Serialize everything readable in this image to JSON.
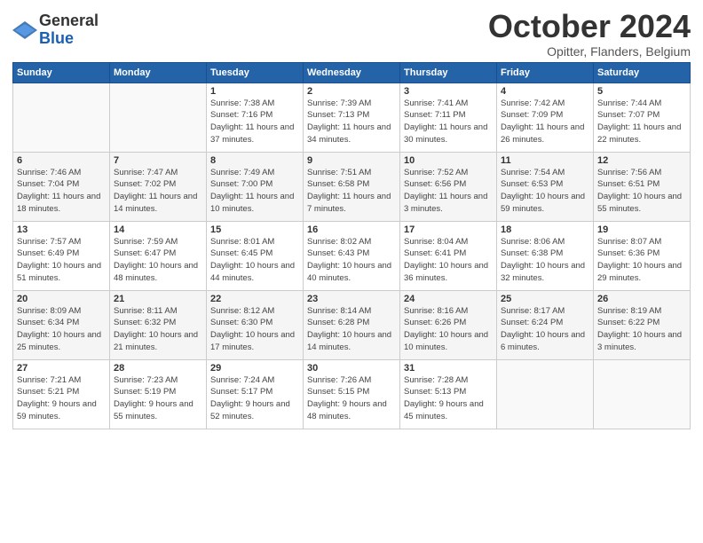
{
  "header": {
    "logo_general": "General",
    "logo_blue": "Blue",
    "month": "October 2024",
    "location": "Opitter, Flanders, Belgium"
  },
  "weekdays": [
    "Sunday",
    "Monday",
    "Tuesday",
    "Wednesday",
    "Thursday",
    "Friday",
    "Saturday"
  ],
  "weeks": [
    [
      {
        "day": "",
        "sunrise": "",
        "sunset": "",
        "daylight": ""
      },
      {
        "day": "",
        "sunrise": "",
        "sunset": "",
        "daylight": ""
      },
      {
        "day": "1",
        "sunrise": "Sunrise: 7:38 AM",
        "sunset": "Sunset: 7:16 PM",
        "daylight": "Daylight: 11 hours and 37 minutes."
      },
      {
        "day": "2",
        "sunrise": "Sunrise: 7:39 AM",
        "sunset": "Sunset: 7:13 PM",
        "daylight": "Daylight: 11 hours and 34 minutes."
      },
      {
        "day": "3",
        "sunrise": "Sunrise: 7:41 AM",
        "sunset": "Sunset: 7:11 PM",
        "daylight": "Daylight: 11 hours and 30 minutes."
      },
      {
        "day": "4",
        "sunrise": "Sunrise: 7:42 AM",
        "sunset": "Sunset: 7:09 PM",
        "daylight": "Daylight: 11 hours and 26 minutes."
      },
      {
        "day": "5",
        "sunrise": "Sunrise: 7:44 AM",
        "sunset": "Sunset: 7:07 PM",
        "daylight": "Daylight: 11 hours and 22 minutes."
      }
    ],
    [
      {
        "day": "6",
        "sunrise": "Sunrise: 7:46 AM",
        "sunset": "Sunset: 7:04 PM",
        "daylight": "Daylight: 11 hours and 18 minutes."
      },
      {
        "day": "7",
        "sunrise": "Sunrise: 7:47 AM",
        "sunset": "Sunset: 7:02 PM",
        "daylight": "Daylight: 11 hours and 14 minutes."
      },
      {
        "day": "8",
        "sunrise": "Sunrise: 7:49 AM",
        "sunset": "Sunset: 7:00 PM",
        "daylight": "Daylight: 11 hours and 10 minutes."
      },
      {
        "day": "9",
        "sunrise": "Sunrise: 7:51 AM",
        "sunset": "Sunset: 6:58 PM",
        "daylight": "Daylight: 11 hours and 7 minutes."
      },
      {
        "day": "10",
        "sunrise": "Sunrise: 7:52 AM",
        "sunset": "Sunset: 6:56 PM",
        "daylight": "Daylight: 11 hours and 3 minutes."
      },
      {
        "day": "11",
        "sunrise": "Sunrise: 7:54 AM",
        "sunset": "Sunset: 6:53 PM",
        "daylight": "Daylight: 10 hours and 59 minutes."
      },
      {
        "day": "12",
        "sunrise": "Sunrise: 7:56 AM",
        "sunset": "Sunset: 6:51 PM",
        "daylight": "Daylight: 10 hours and 55 minutes."
      }
    ],
    [
      {
        "day": "13",
        "sunrise": "Sunrise: 7:57 AM",
        "sunset": "Sunset: 6:49 PM",
        "daylight": "Daylight: 10 hours and 51 minutes."
      },
      {
        "day": "14",
        "sunrise": "Sunrise: 7:59 AM",
        "sunset": "Sunset: 6:47 PM",
        "daylight": "Daylight: 10 hours and 48 minutes."
      },
      {
        "day": "15",
        "sunrise": "Sunrise: 8:01 AM",
        "sunset": "Sunset: 6:45 PM",
        "daylight": "Daylight: 10 hours and 44 minutes."
      },
      {
        "day": "16",
        "sunrise": "Sunrise: 8:02 AM",
        "sunset": "Sunset: 6:43 PM",
        "daylight": "Daylight: 10 hours and 40 minutes."
      },
      {
        "day": "17",
        "sunrise": "Sunrise: 8:04 AM",
        "sunset": "Sunset: 6:41 PM",
        "daylight": "Daylight: 10 hours and 36 minutes."
      },
      {
        "day": "18",
        "sunrise": "Sunrise: 8:06 AM",
        "sunset": "Sunset: 6:38 PM",
        "daylight": "Daylight: 10 hours and 32 minutes."
      },
      {
        "day": "19",
        "sunrise": "Sunrise: 8:07 AM",
        "sunset": "Sunset: 6:36 PM",
        "daylight": "Daylight: 10 hours and 29 minutes."
      }
    ],
    [
      {
        "day": "20",
        "sunrise": "Sunrise: 8:09 AM",
        "sunset": "Sunset: 6:34 PM",
        "daylight": "Daylight: 10 hours and 25 minutes."
      },
      {
        "day": "21",
        "sunrise": "Sunrise: 8:11 AM",
        "sunset": "Sunset: 6:32 PM",
        "daylight": "Daylight: 10 hours and 21 minutes."
      },
      {
        "day": "22",
        "sunrise": "Sunrise: 8:12 AM",
        "sunset": "Sunset: 6:30 PM",
        "daylight": "Daylight: 10 hours and 17 minutes."
      },
      {
        "day": "23",
        "sunrise": "Sunrise: 8:14 AM",
        "sunset": "Sunset: 6:28 PM",
        "daylight": "Daylight: 10 hours and 14 minutes."
      },
      {
        "day": "24",
        "sunrise": "Sunrise: 8:16 AM",
        "sunset": "Sunset: 6:26 PM",
        "daylight": "Daylight: 10 hours and 10 minutes."
      },
      {
        "day": "25",
        "sunrise": "Sunrise: 8:17 AM",
        "sunset": "Sunset: 6:24 PM",
        "daylight": "Daylight: 10 hours and 6 minutes."
      },
      {
        "day": "26",
        "sunrise": "Sunrise: 8:19 AM",
        "sunset": "Sunset: 6:22 PM",
        "daylight": "Daylight: 10 hours and 3 minutes."
      }
    ],
    [
      {
        "day": "27",
        "sunrise": "Sunrise: 7:21 AM",
        "sunset": "Sunset: 5:21 PM",
        "daylight": "Daylight: 9 hours and 59 minutes."
      },
      {
        "day": "28",
        "sunrise": "Sunrise: 7:23 AM",
        "sunset": "Sunset: 5:19 PM",
        "daylight": "Daylight: 9 hours and 55 minutes."
      },
      {
        "day": "29",
        "sunrise": "Sunrise: 7:24 AM",
        "sunset": "Sunset: 5:17 PM",
        "daylight": "Daylight: 9 hours and 52 minutes."
      },
      {
        "day": "30",
        "sunrise": "Sunrise: 7:26 AM",
        "sunset": "Sunset: 5:15 PM",
        "daylight": "Daylight: 9 hours and 48 minutes."
      },
      {
        "day": "31",
        "sunrise": "Sunrise: 7:28 AM",
        "sunset": "Sunset: 5:13 PM",
        "daylight": "Daylight: 9 hours and 45 minutes."
      },
      {
        "day": "",
        "sunrise": "",
        "sunset": "",
        "daylight": ""
      },
      {
        "day": "",
        "sunrise": "",
        "sunset": "",
        "daylight": ""
      }
    ]
  ]
}
